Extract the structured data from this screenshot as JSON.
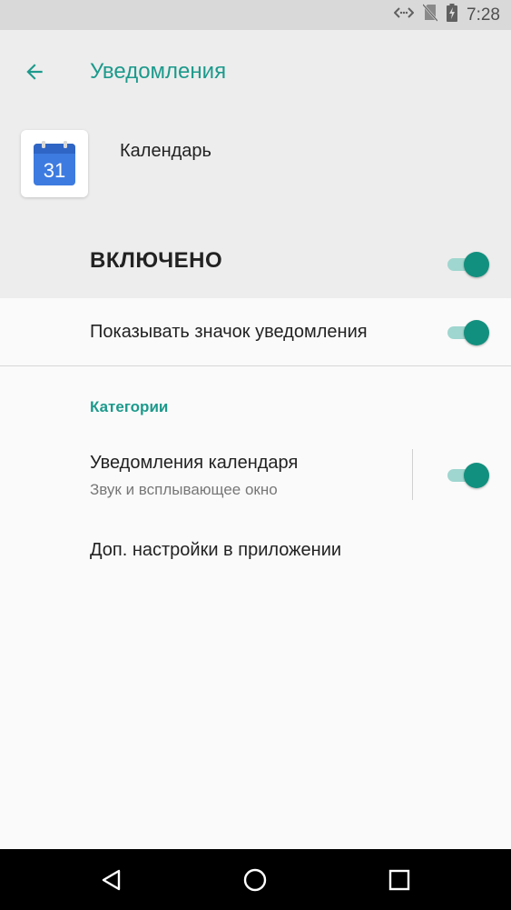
{
  "status_bar": {
    "time": "7:28",
    "icons": [
      "data-transfer-icon",
      "no-sim-icon",
      "battery-charging-icon"
    ]
  },
  "header": {
    "title": "Уведомления",
    "back_icon": "arrow-left-icon",
    "app_name": "Календарь",
    "app_icon_text": "31",
    "master_toggle_label": "ВКЛЮЧЕНО",
    "master_toggle_on": true
  },
  "settings": {
    "show_badge_label": "Показывать значок уведомления",
    "show_badge_on": true,
    "categories_header": "Категории",
    "calendar_notifications_label": "Уведомления календаря",
    "calendar_notifications_sub": "Звук и всплывающее окно",
    "calendar_notifications_on": true,
    "app_settings_label": "Доп. настройки в приложении"
  },
  "nav_bar": {
    "icons": [
      "back-triangle-icon",
      "home-circle-icon",
      "recents-square-icon"
    ]
  },
  "colors": {
    "accent": "#1c9a8c",
    "toggle_thumb": "#12907f",
    "toggle_track": "#9fd6cf",
    "header_bg": "#ededed",
    "status_bg": "#d9d9d9"
  }
}
